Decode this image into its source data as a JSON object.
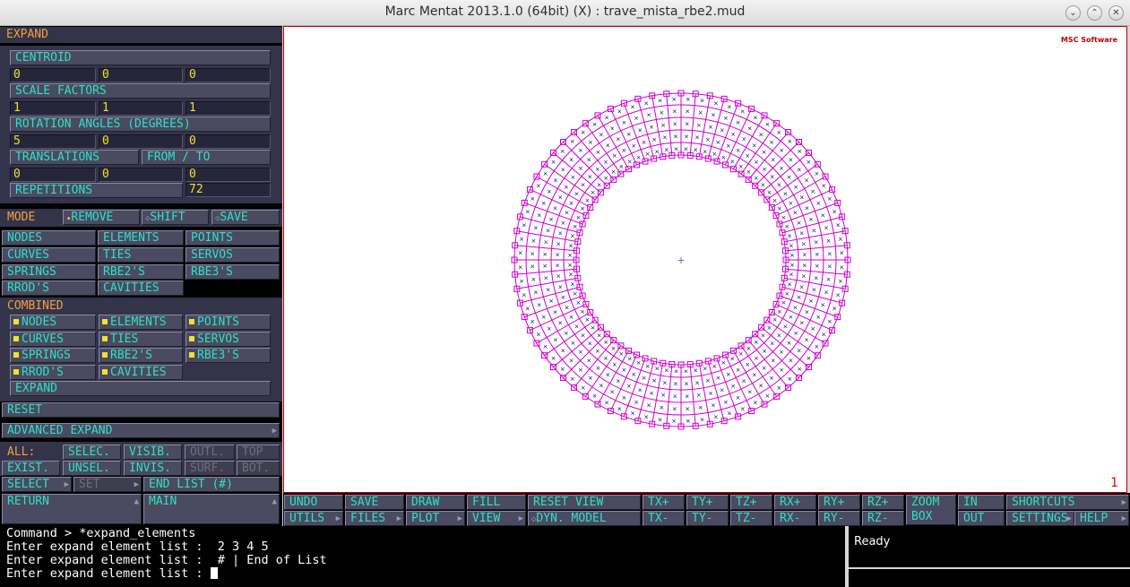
{
  "window": {
    "title": "Marc Mentat 2013.1.0 (64bit) (X) : trave_mista_rbe2.mud",
    "buttons": {
      "minimize": "⌄",
      "maximize": "⌃",
      "close": "✕"
    }
  },
  "panel": {
    "title": "EXPAND",
    "centroid": {
      "label": "CENTROID",
      "values": [
        "0",
        "0",
        "0"
      ]
    },
    "scale_factors": {
      "label": "SCALE FACTORS",
      "values": [
        "1",
        "1",
        "1"
      ]
    },
    "rotation_angles": {
      "label": "ROTATION ANGLES (DEGREES)",
      "values": [
        "5",
        "0",
        "0"
      ]
    },
    "translations": {
      "label": "TRANSLATIONS",
      "from_to": "FROM / TO",
      "values": [
        "0",
        "0",
        "0"
      ]
    },
    "repetitions": {
      "label": "REPETITIONS",
      "value": "72"
    },
    "mode": {
      "label": "MODE",
      "remove": "REMOVE",
      "shift": "SHIFT",
      "save": "SAVE"
    },
    "entities": [
      "NODES",
      "ELEMENTS",
      "POINTS",
      "CURVES",
      "TIES",
      "SERVOS",
      "SPRINGS",
      "RBE2'S",
      "RBE3'S",
      "RROD'S",
      "CAVITIES"
    ],
    "combined": {
      "label": "COMBINED",
      "items": [
        "NODES",
        "ELEMENTS",
        "POINTS",
        "CURVES",
        "TIES",
        "SERVOS",
        "SPRINGS",
        "RBE2'S",
        "RBE3'S",
        "RROD'S",
        "CAVITIES"
      ],
      "expand": "EXPAND"
    },
    "reset": "RESET",
    "advanced_expand": "ADVANCED EXPAND",
    "all": {
      "label": "ALL:",
      "selec": "SELEC.",
      "visib": "VISIB.",
      "outl": "OUTL.",
      "top": "TOP",
      "exist": "EXIST.",
      "unsel": "UNSEL.",
      "invis": "INVIS.",
      "surf": "SURF.",
      "bot": "BOT."
    },
    "select": "SELECT",
    "set": "SET",
    "end_list": "END LIST (#)",
    "return": "RETURN",
    "main": "MAIN"
  },
  "viewport": {
    "logo": "MSC Software",
    "number": "1"
  },
  "toolbar": {
    "undo": "UNDO",
    "save": "SAVE",
    "draw": "DRAW",
    "fill": "FILL",
    "reset_view": "RESET VIEW",
    "tx_plus": "TX+",
    "ty_plus": "TY+",
    "tz_plus": "TZ+",
    "rx_plus": "RX+",
    "ry_plus": "RY+",
    "rz_plus": "RZ+",
    "zoom": "ZOOM",
    "box": "BOX",
    "in": "IN",
    "shortcuts": "SHORTCUTS",
    "utils": "UTILS",
    "files": "FILES",
    "plot": "PLOT",
    "view": "VIEW",
    "dyn_model": "DYN. MODEL",
    "tx_minus": "TX-",
    "ty_minus": "TY-",
    "tz_minus": "TZ-",
    "rx_minus": "RX-",
    "ry_minus": "RY-",
    "rz_minus": "RZ-",
    "out": "OUT",
    "settings": "SETTINGS",
    "help": "HELP"
  },
  "console": {
    "lines": [
      "Command > *expand_elements",
      "Enter expand element list :  2 3 4 5",
      "Enter expand element list :  # | End of List",
      "Enter expand element list : "
    ]
  },
  "status": "Ready",
  "colors": {
    "panel_bg": "#33334a",
    "button_text": "#30e0c8",
    "header_text": "#f2a040",
    "value_text": "#f0e030",
    "mesh": "#cc00cc",
    "node_marker": "#000080"
  }
}
